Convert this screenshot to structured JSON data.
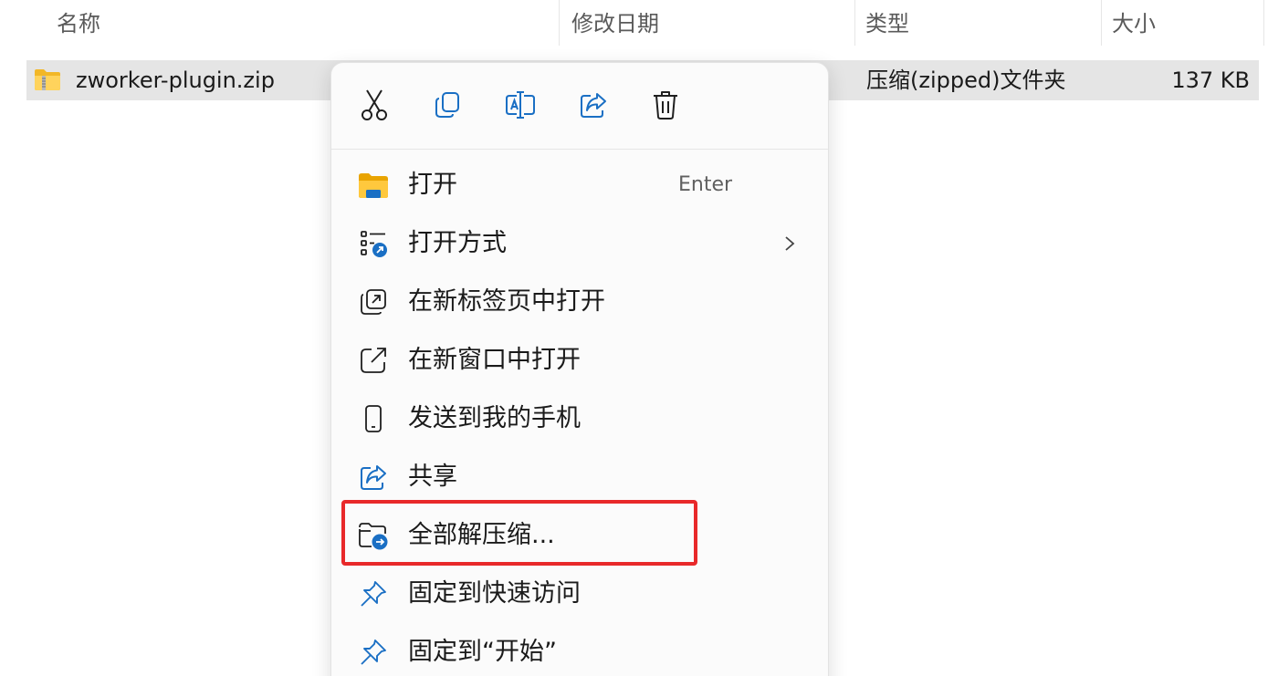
{
  "columns": {
    "name": "名称",
    "modified": "修改日期",
    "type": "类型",
    "size": "大小"
  },
  "file": {
    "name": "zworker-plugin.zip",
    "type": "压缩(zipped)文件夹",
    "size": "137 KB",
    "icon": "zip-folder-icon"
  },
  "toolbar": {
    "icons": [
      "cut-icon",
      "copy-icon",
      "rename-icon",
      "share-icon",
      "delete-icon"
    ]
  },
  "menu": {
    "items": [
      {
        "label": "打开",
        "shortcut": "Enter",
        "icon": "folder-icon"
      },
      {
        "label": "打开方式",
        "icon": "open-with-icon",
        "submenu": true
      },
      {
        "label": "在新标签页中打开",
        "icon": "new-tab-icon"
      },
      {
        "label": "在新窗口中打开",
        "icon": "new-window-icon"
      },
      {
        "label": "发送到我的手机",
        "icon": "phone-icon"
      },
      {
        "label": "共享",
        "icon": "share-icon"
      },
      {
        "label": "全部解压缩...",
        "icon": "extract-all-icon"
      },
      {
        "label": "固定到快速访问",
        "icon": "pin-icon"
      },
      {
        "label": "固定到“开始”",
        "icon": "pin-icon"
      }
    ]
  },
  "colors": {
    "accent": "#1a6fc4",
    "highlight": "#e8292a",
    "selected_row": "#e5e5e5"
  }
}
